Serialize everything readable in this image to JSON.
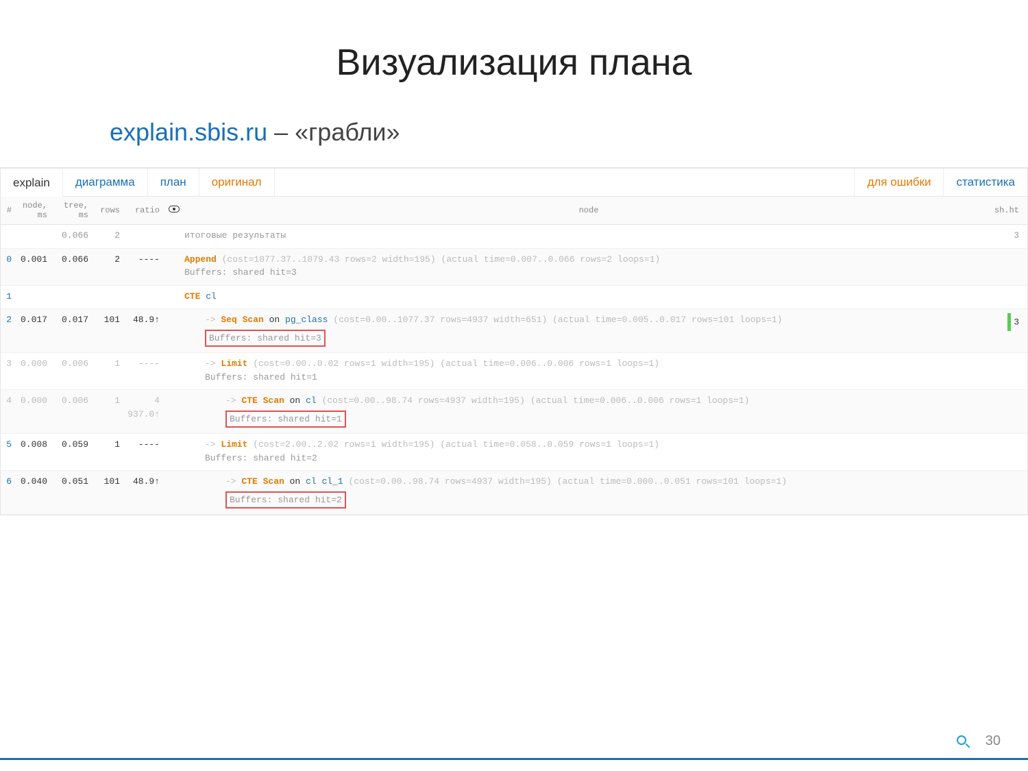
{
  "title": "Визуализация плана",
  "subtitle_link": "explain.sbis.ru",
  "subtitle_rest": " – «грабли»",
  "tabs": {
    "explain": "explain",
    "diagram": "диаграмма",
    "plan": "план",
    "original": "оригинал",
    "error": "для ошибки",
    "stats": "статистика"
  },
  "headers": {
    "num": "#",
    "node_ms": "node, ms",
    "tree_ms": "tree, ms",
    "rows": "rows",
    "ratio": "ratio",
    "node": "node",
    "sh": "sh.ht"
  },
  "total_row": {
    "tree": "0.066",
    "rows": "2",
    "label": "итоговые результаты",
    "sh": "3"
  },
  "rows": [
    {
      "n": "0",
      "node": "0.001",
      "tree": "0.066",
      "rows": "2",
      "ratio": "----",
      "indent": 0,
      "bar1": "green",
      "bar2": "green",
      "line": {
        "kw": "Append",
        "rest": "  (cost=1077.37..1079.43 rows=2 width=195) (actual time=0.007..0.066 rows=2 loops=1)"
      },
      "buf": "Buffers: shared hit=3",
      "buf_box": false
    },
    {
      "n": "1",
      "indent": 0,
      "cte": "CTE",
      "cte_obj": "cl"
    },
    {
      "n": "2",
      "node": "0.017",
      "tree": "0.017",
      "rows": "101",
      "ratio": "48.9↑",
      "indent": 1,
      "bar1": "green",
      "bar2": "red",
      "arrow": "->",
      "line": {
        "kw": "Seq Scan",
        "mid": " on ",
        "obj": "pg_class",
        "rest": "  (cost=0.00..1077.37 rows=4937 width=651) (actual time=0.005..0.017 rows=101 loops=1)"
      },
      "buf": "Buffers: shared hit=3",
      "buf_box": true,
      "sh": "3",
      "sh_bar": true
    },
    {
      "n": "3",
      "node": "0.000",
      "tree": "0.006",
      "rows": "1",
      "ratio": "----",
      "indent": 1,
      "muted": true,
      "arrow": "->",
      "line": {
        "kw": "Limit",
        "rest": "  (cost=0.00..0.02 rows=1 width=195) (actual time=0.006..0.006 rows=1 loops=1)"
      },
      "buf": "Buffers: shared hit=1",
      "buf_box": false
    },
    {
      "n": "4",
      "node": "0.000",
      "tree": "0.006",
      "rows": "1",
      "ratio": "4 937.0↑",
      "indent": 2,
      "muted": true,
      "arrow": "->",
      "line": {
        "kw": "CTE Scan",
        "mid": " on ",
        "obj": "cl",
        "rest": "  (cost=0.00..98.74 rows=4937 width=195) (actual time=0.006..0.006 rows=1 loops=1)"
      },
      "buf": "Buffers: shared hit=1",
      "buf_box": true
    },
    {
      "n": "5",
      "node": "0.008",
      "tree": "0.059",
      "rows": "1",
      "ratio": "----",
      "indent": 1,
      "bar1": "green",
      "bar2": "green",
      "arrow": "->",
      "line": {
        "kw": "Limit",
        "rest": "  (cost=2.00..2.02 rows=1 width=195) (actual time=0.058..0.059 rows=1 loops=1)"
      },
      "buf": "Buffers: shared hit=2",
      "buf_box": false
    },
    {
      "n": "6",
      "node": "0.040",
      "tree": "0.051",
      "rows": "101",
      "ratio": "48.9↑",
      "indent": 2,
      "bar1": "red",
      "bar2": "red",
      "arrow": "->",
      "line": {
        "kw": "CTE Scan",
        "mid": " on ",
        "obj": "cl cl_1",
        "rest": "  (cost=0.00..98.74 rows=4937 width=195) (actual time=0.000..0.051 rows=101 loops=1)"
      },
      "buf": "Buffers: shared hit=2",
      "buf_box": true
    }
  ],
  "page": "30"
}
